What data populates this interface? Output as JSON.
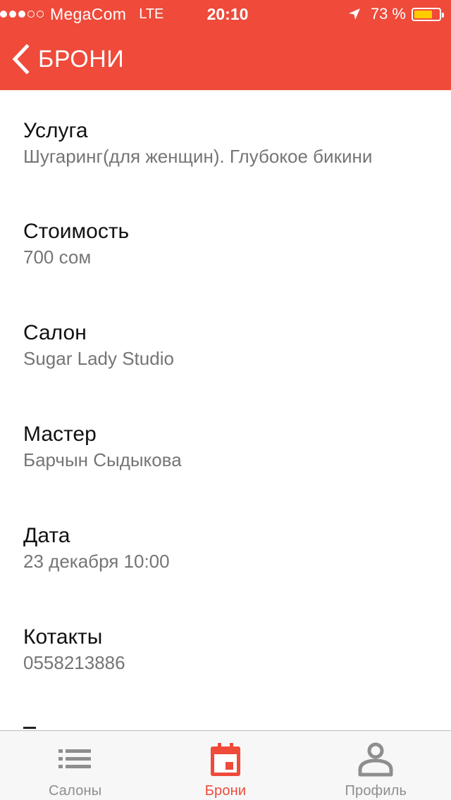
{
  "status_bar": {
    "signal_filled": 3,
    "signal_total": 5,
    "carrier": "MegaCom",
    "network": "LTE",
    "time": "20:10",
    "location_icon": "location-arrow-icon",
    "battery_percent": "73 %",
    "battery_level": 0.73,
    "battery_color": "#ffcc00"
  },
  "nav": {
    "back_icon": "chevron-left-icon",
    "title": "БРОНИ",
    "background": "#ef4a3a"
  },
  "details": [
    {
      "label": "Услуга",
      "value": "Шугаринг(для женщин). Глубокое бикини"
    },
    {
      "label": "Стоимость",
      "value": "700 сом"
    },
    {
      "label": "Салон",
      "value": "Sugar Lady Studio"
    },
    {
      "label": "Мастер",
      "value": "Барчын Сыдыкова"
    },
    {
      "label": "Дата",
      "value": "23 декабря 10:00"
    },
    {
      "label": "Котакты",
      "value": "0558213886"
    }
  ],
  "tabs": [
    {
      "label": "Салоны",
      "icon": "list-icon",
      "active": false
    },
    {
      "label": "Брони",
      "icon": "calendar-icon",
      "active": true
    },
    {
      "label": "Профиль",
      "icon": "person-icon",
      "active": false
    }
  ],
  "colors": {
    "accent": "#ef4a3a",
    "inactive_tab": "#8e8e8e",
    "value_text": "#757575"
  }
}
